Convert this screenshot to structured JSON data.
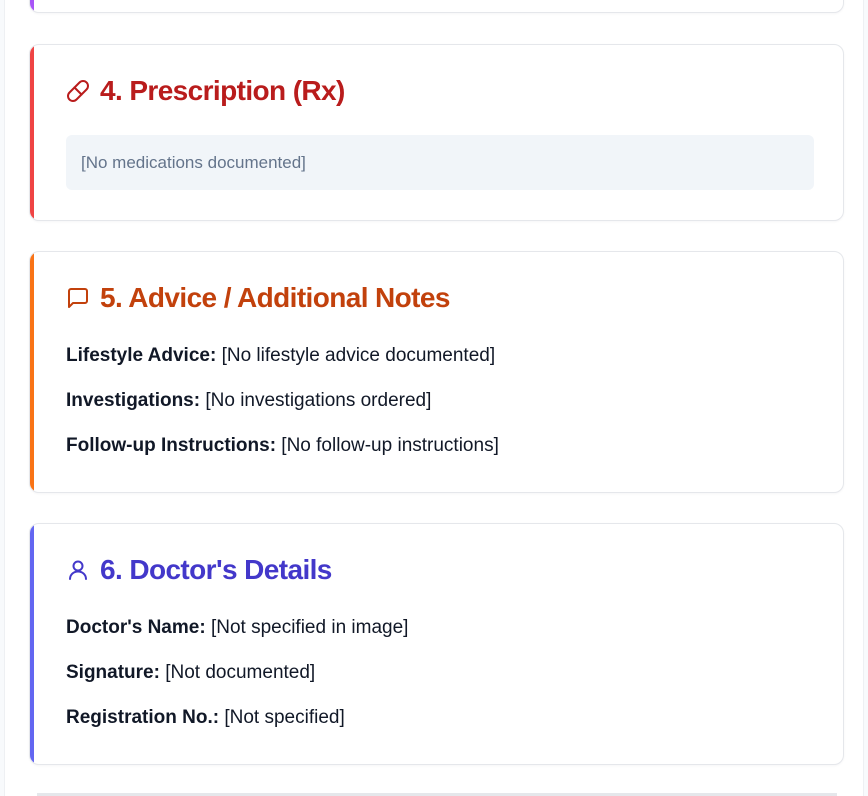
{
  "sections": {
    "prescription": {
      "title": "4. Prescription (Rx)",
      "icon": "pill-icon",
      "accent": "#ef4444",
      "empty_text": "[No medications documented]"
    },
    "advice": {
      "title": "5. Advice / Additional Notes",
      "icon": "message-square-icon",
      "accent": "#f97316",
      "fields": [
        {
          "label": "Lifestyle Advice:",
          "value": " [No lifestyle advice documented]"
        },
        {
          "label": "Investigations:",
          "value": " [No investigations ordered]"
        },
        {
          "label": "Follow-up Instructions:",
          "value": " [No follow-up instructions]"
        }
      ]
    },
    "doctor": {
      "title": "6. Doctor's Details",
      "icon": "user-icon",
      "accent": "#6366f1",
      "fields": [
        {
          "label": "Doctor's Name:",
          "value": " [Not specified in image]"
        },
        {
          "label": "Signature:",
          "value": " [Not documented]"
        },
        {
          "label": "Registration No.:",
          "value": " [Not specified]"
        }
      ]
    },
    "previous": {
      "accent": "#a855f7"
    }
  }
}
